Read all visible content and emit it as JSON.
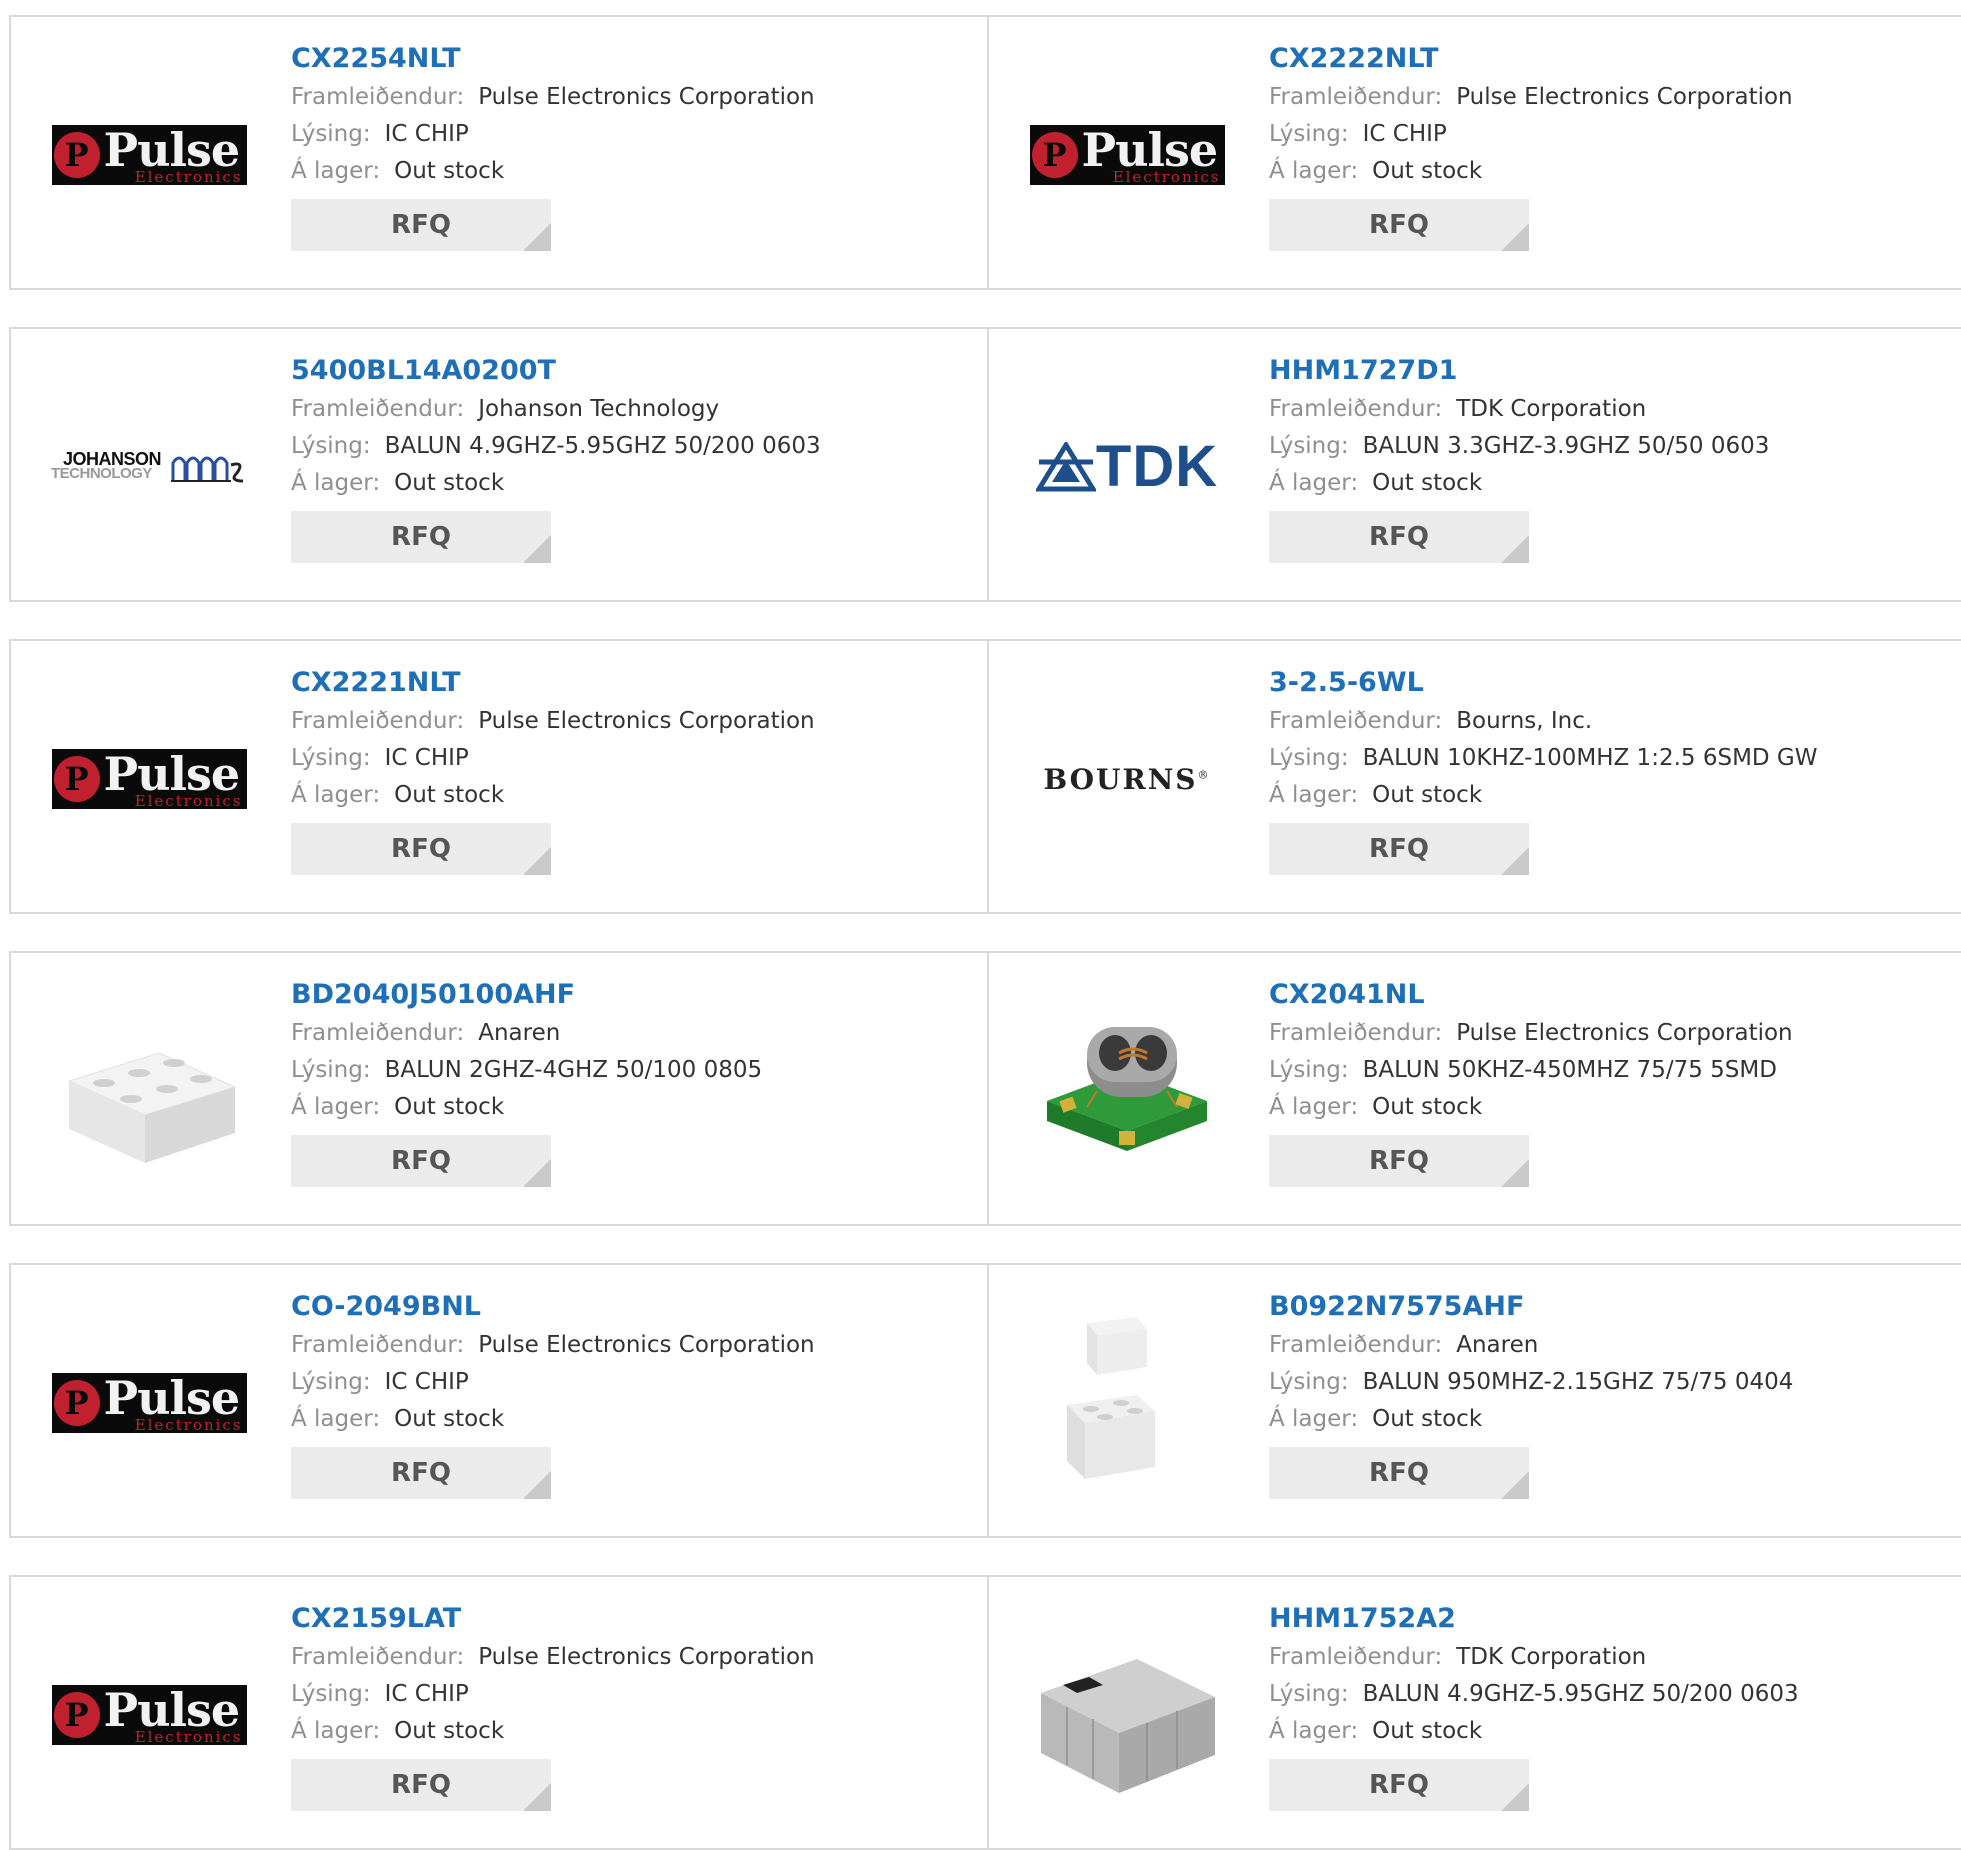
{
  "labels": {
    "manufacturer": "Framleiðendur:",
    "description": "Lýsing:",
    "stock": "Á lager:",
    "rfq": "RFQ"
  },
  "colors": {
    "part_link": "#1e6fb6",
    "label": "#8f8f8f",
    "value": "#333333",
    "rfq_bg": "#ebebeb",
    "border": "#d9d9d9"
  },
  "products": [
    {
      "part": "CX2254NLT",
      "manufacturer": "Pulse Electronics Corporation",
      "description": "IC CHIP",
      "stock": "Out stock",
      "image": "pulse-logo"
    },
    {
      "part": "CX2222NLT",
      "manufacturer": "Pulse Electronics Corporation",
      "description": "IC CHIP",
      "stock": "Out stock",
      "image": "pulse-logo"
    },
    {
      "part": "5400BL14A0200T",
      "manufacturer": "Johanson Technology",
      "description": "BALUN 4.9GHZ-5.95GHZ 50/200 0603",
      "stock": "Out stock",
      "image": "johanson-logo",
      "logo_text_1": "JOHANSON",
      "logo_text_2": "TECHNOLOGY"
    },
    {
      "part": "HHM1727D1",
      "manufacturer": "TDK Corporation",
      "description": "BALUN 3.3GHZ-3.9GHZ 50/50 0603",
      "stock": "Out stock",
      "image": "tdk-logo",
      "logo_text_1": "TDK"
    },
    {
      "part": "CX2221NLT",
      "manufacturer": "Pulse Electronics Corporation",
      "description": "IC CHIP",
      "stock": "Out stock",
      "image": "pulse-logo"
    },
    {
      "part": "3-2.5-6WL",
      "manufacturer": "Bourns, Inc.",
      "description": "BALUN 10KHZ-100MHZ 1:2.5 6SMD GW",
      "stock": "Out stock",
      "image": "bourns-logo",
      "logo_text_1": "BOURNS"
    },
    {
      "part": "BD2040J50100AHF",
      "manufacturer": "Anaren",
      "description": "BALUN 2GHZ-4GHZ 50/100 0805",
      "stock": "Out stock",
      "image": "white-chip-photo"
    },
    {
      "part": "CX2041NL",
      "manufacturer": "Pulse Electronics Corporation",
      "description": "BALUN 50KHZ-450MHZ 75/75 5SMD",
      "stock": "Out stock",
      "image": "transformer-photo"
    },
    {
      "part": "CO-2049BNL",
      "manufacturer": "Pulse Electronics Corporation",
      "description": "IC CHIP",
      "stock": "Out stock",
      "image": "pulse-logo"
    },
    {
      "part": "B0922N7575AHF",
      "manufacturer": "Anaren",
      "description": "BALUN 950MHZ-2.15GHZ 75/75 0404",
      "stock": "Out stock",
      "image": "small-chips-photo"
    },
    {
      "part": "CX2159LAT",
      "manufacturer": "Pulse Electronics Corporation",
      "description": "IC CHIP",
      "stock": "Out stock",
      "image": "pulse-logo"
    },
    {
      "part": "HHM1752A2",
      "manufacturer": "TDK Corporation",
      "description": "BALUN 4.9GHZ-5.95GHZ 50/200 0603",
      "stock": "Out stock",
      "image": "gray-chip-photo"
    }
  ],
  "pulse_logo": {
    "word": "Pulse",
    "sub": "Electronics"
  }
}
